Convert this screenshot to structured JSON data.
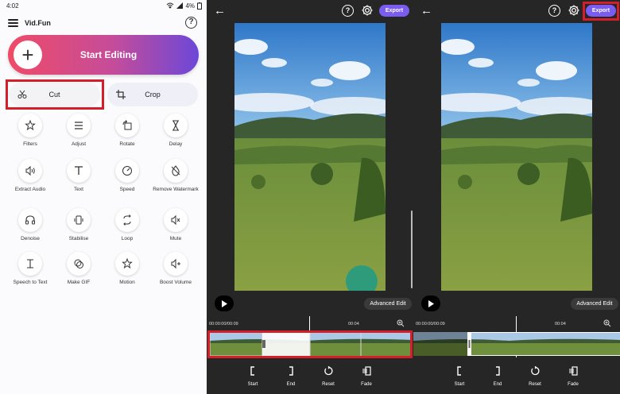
{
  "home": {
    "status": {
      "time": "4:02",
      "battery": "4%"
    },
    "app_name": "Vid.Fun",
    "start_label": "Start Editing",
    "cut_label": "Cut",
    "crop_label": "Crop",
    "tools": [
      {
        "label": "Filters",
        "icon": "filters-icon"
      },
      {
        "label": "Adjust",
        "icon": "adjust-icon"
      },
      {
        "label": "Rotate",
        "icon": "rotate-icon"
      },
      {
        "label": "Delay",
        "icon": "hourglass-icon"
      },
      {
        "label": "Extract Audio",
        "icon": "audio-icon"
      },
      {
        "label": "Text",
        "icon": "text-icon"
      },
      {
        "label": "Speed",
        "icon": "speed-icon"
      },
      {
        "label": "Remove Watermark",
        "icon": "watermark-icon"
      },
      {
        "label": "Denoise",
        "icon": "headphones-icon"
      },
      {
        "label": "Stabilise",
        "icon": "stabilise-icon"
      },
      {
        "label": "Loop",
        "icon": "loop-icon"
      },
      {
        "label": "Mute",
        "icon": "mute-icon"
      },
      {
        "label": "Speech to Text",
        "icon": "speech-text-icon"
      },
      {
        "label": "Make GIF",
        "icon": "gif-icon"
      },
      {
        "label": "Motion",
        "icon": "motion-icon"
      },
      {
        "label": "Boost Volume",
        "icon": "boost-volume-icon"
      }
    ]
  },
  "editor": {
    "help": "?",
    "export_label": "Export",
    "advanced_label": "Advanced Edit",
    "time_current": "00:00:00/00:09",
    "time_end": "00:04",
    "tools": {
      "start": "Start",
      "end": "End",
      "reset": "Reset",
      "fade": "Fade"
    }
  },
  "colors": {
    "accent": "#7b5cf0",
    "highlight": "#d41e2a",
    "gradient_start": "#ef4b67",
    "gradient_end": "#6c48d8"
  }
}
